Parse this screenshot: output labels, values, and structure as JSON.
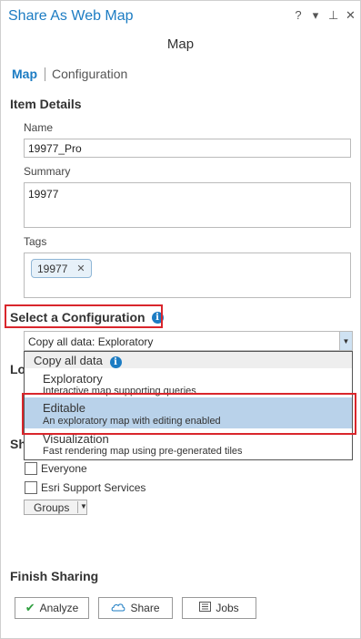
{
  "window": {
    "title": "Share As Web Map",
    "controls": [
      "?",
      "▾",
      "⊥",
      "✕"
    ]
  },
  "heading": "Map",
  "tabs": {
    "map": "Map",
    "configuration": "Configuration"
  },
  "item_details": {
    "section_title": "Item Details",
    "name_label": "Name",
    "name_value": "19977_Pro",
    "summary_label": "Summary",
    "summary_value": "19977",
    "tags_label": "Tags",
    "tag_chip": "19977",
    "tag_remove": "✕"
  },
  "configuration": {
    "section_title": "Select a Configuration",
    "selected": "Copy all data: Exploratory",
    "dropdown": {
      "group": "Copy all data",
      "items": [
        {
          "title": "Exploratory",
          "desc": "Interactive map supporting queries"
        },
        {
          "title": "Editable",
          "desc": "An exploratory map with editing enabled"
        },
        {
          "title": "Visualization",
          "desc": "Fast rendering map using pre-generated tiles"
        }
      ]
    }
  },
  "hidden_labels": {
    "location_prefix": "Lo",
    "share_prefix": "Sh"
  },
  "share_options": {
    "everyone": "Everyone",
    "esri": "Esri Support Services",
    "groups": "Groups"
  },
  "finish": {
    "section_title": "Finish Sharing",
    "analyze": "Analyze",
    "share": "Share",
    "jobs": "Jobs"
  },
  "colors": {
    "accent": "#1c7cc3",
    "highlight": "#b9d2ea",
    "callout": "#d9262c"
  }
}
